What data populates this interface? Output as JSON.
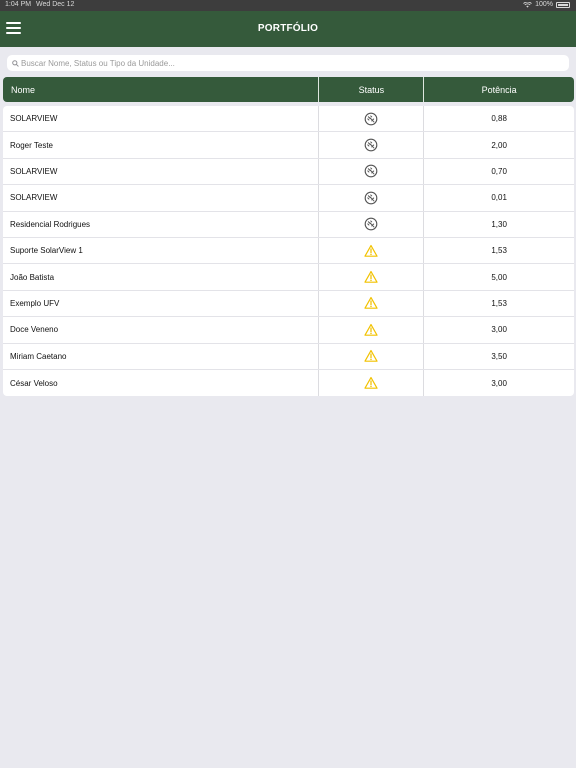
{
  "status_bar": {
    "time": "1:04 PM",
    "date": "Wed Dec 12",
    "battery": "100%"
  },
  "header": {
    "title": "PORTFÓLIO"
  },
  "search": {
    "placeholder": "Buscar Nome, Status ou Tipo da Unidade..."
  },
  "table": {
    "columns": [
      "Nome",
      "Status",
      "Potência"
    ],
    "rows": [
      {
        "name": "SOLARVIEW",
        "status": "offline",
        "power": "0,88"
      },
      {
        "name": "Roger Teste",
        "status": "offline",
        "power": "2,00"
      },
      {
        "name": "SOLARVIEW",
        "status": "offline",
        "power": "0,70"
      },
      {
        "name": "SOLARVIEW",
        "status": "offline",
        "power": "0,01"
      },
      {
        "name": "Residencial Rodrigues",
        "status": "offline",
        "power": "1,30"
      },
      {
        "name": "Suporte SolarView 1",
        "status": "warning",
        "power": "1,53"
      },
      {
        "name": "João Batista",
        "status": "warning",
        "power": "5,00"
      },
      {
        "name": "Exemplo UFV",
        "status": "warning",
        "power": "1,53"
      },
      {
        "name": "Doce Veneno",
        "status": "warning",
        "power": "3,00"
      },
      {
        "name": "Miriam Caetano",
        "status": "warning",
        "power": "3,50"
      },
      {
        "name": "César Veloso",
        "status": "warning",
        "power": "3,00"
      }
    ]
  },
  "colors": {
    "brand": "#355a3b",
    "warning": "#f2c200",
    "offline": "#555555",
    "background": "#e9e9ef"
  },
  "icons": {
    "offline": "disconnected-plug-icon",
    "warning": "warning-triangle-icon"
  }
}
